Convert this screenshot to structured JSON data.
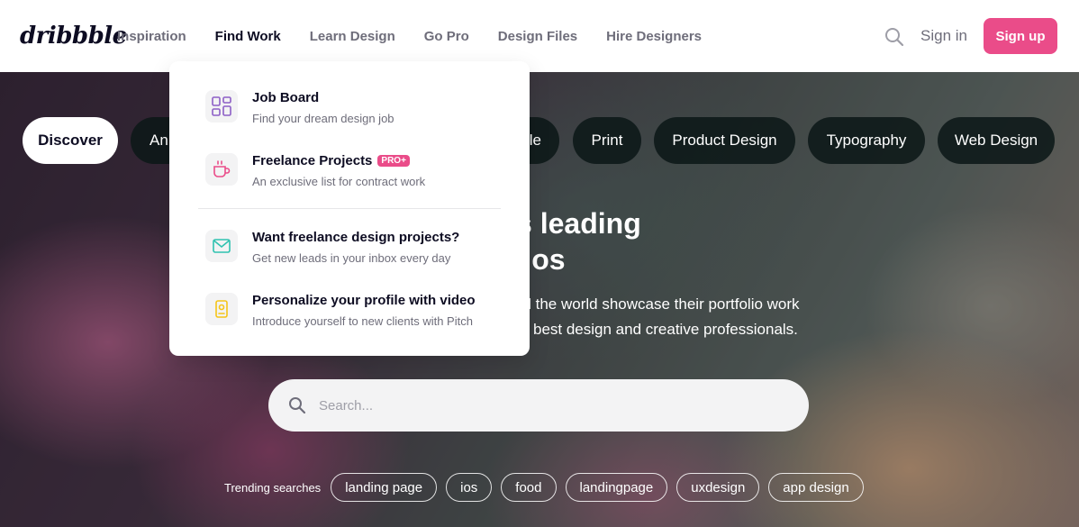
{
  "header": {
    "logo": "dribbble",
    "nav": [
      "Inspiration",
      "Find Work",
      "Learn Design",
      "Go Pro",
      "Design Files",
      "Hire Designers"
    ],
    "active_nav": "Find Work",
    "sign_in": "Sign in",
    "sign_up": "Sign up"
  },
  "dropdown": {
    "items": [
      {
        "title": "Job Board",
        "desc": "Find your dream design job",
        "icon": "grid-icon"
      },
      {
        "title": "Freelance Projects",
        "badge": "PRO+",
        "desc": "An exclusive list for contract work",
        "icon": "coffee-cup-icon"
      },
      {
        "title": "Want freelance design projects?",
        "desc": "Get new leads in your inbox every day",
        "icon": "envelope-icon"
      },
      {
        "title": "Personalize your profile with video",
        "desc": "Introduce yourself to new clients with Pitch",
        "icon": "profile-badge-icon"
      }
    ]
  },
  "categories": [
    "Discover",
    "An",
    "le",
    "Print",
    "Product Design",
    "Typography",
    "Web Design"
  ],
  "hero": {
    "headline_line1": "world’s leading",
    "headline_line2": "portfolios",
    "sub_line1": "nd the world showcase their portfolio work",
    "sub_line2": "best design and creative professionals."
  },
  "search": {
    "placeholder": "Search..."
  },
  "trending": {
    "label": "Trending searches",
    "tags": [
      "landing page",
      "ios",
      "food",
      "landingpage",
      "uxdesign",
      "app design"
    ]
  },
  "colors": {
    "brand_pink": "#ea4c89",
    "text_dark": "#0d0c22",
    "text_gray": "#6e6d7a"
  }
}
